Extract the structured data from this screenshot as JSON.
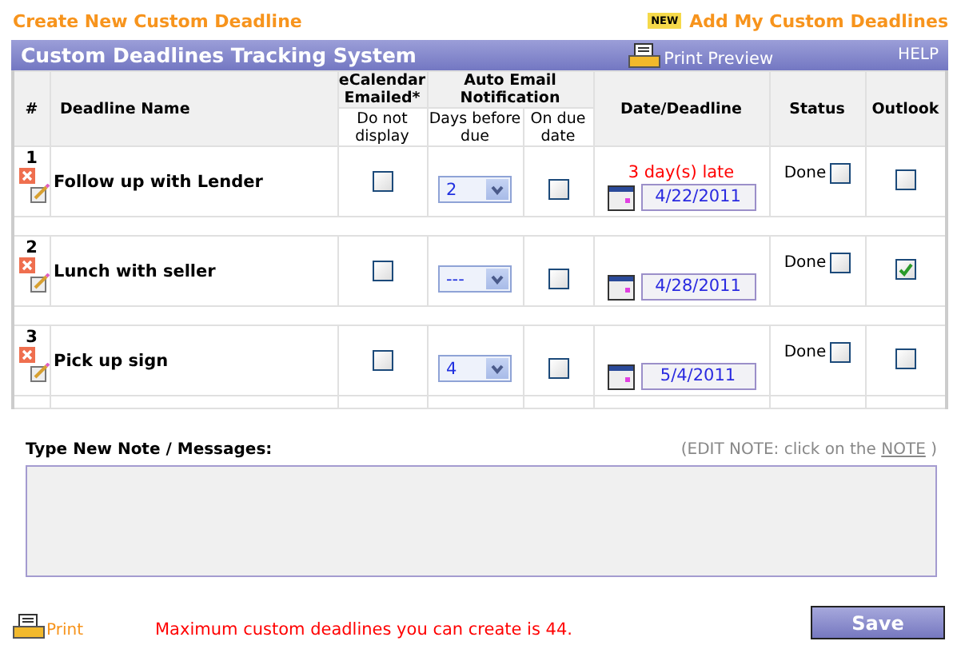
{
  "header": {
    "create_link": "Create New Custom Deadline",
    "new_badge": "NEW",
    "add_link": "Add My Custom Deadlines"
  },
  "panel": {
    "title": "Custom Deadlines Tracking System",
    "print_preview": "Print Preview",
    "help": "HELP"
  },
  "columns": {
    "number": "#",
    "name": "Deadline Name",
    "ecalendar": "eCalendar Emailed*",
    "auto_email": "Auto Email Notification",
    "date": "Date/Deadline",
    "status": "Status",
    "outlook": "Outlook",
    "do_not_display": "Do not display",
    "days_before": "Days before due",
    "on_due_date": "On due date"
  },
  "rows": [
    {
      "number": "1",
      "name": "Follow up with Lender",
      "do_not_display": false,
      "days_before": "2",
      "on_due_date": false,
      "late_note": "3 day(s) late",
      "date": "4/22/2011",
      "status_label": "Done",
      "done": false,
      "outlook": false
    },
    {
      "number": "2",
      "name": "Lunch with seller",
      "do_not_display": false,
      "days_before": "---",
      "on_due_date": false,
      "date": "4/28/2011",
      "status_label": "Done",
      "done": false,
      "outlook": true
    },
    {
      "number": "3",
      "name": "Pick up sign",
      "do_not_display": false,
      "days_before": "4",
      "on_due_date": false,
      "date": "5/4/2011",
      "status_label": "Done",
      "done": false,
      "outlook": false
    }
  ],
  "note": {
    "label": "Type New Note / Messages:",
    "hint_before": "(EDIT NOTE: click on the",
    "hint_link": "NOTE",
    "hint_after": ")"
  },
  "footer": {
    "print": "Print",
    "message": "Maximum custom deadlines you can create is 44.",
    "save": "Save"
  }
}
